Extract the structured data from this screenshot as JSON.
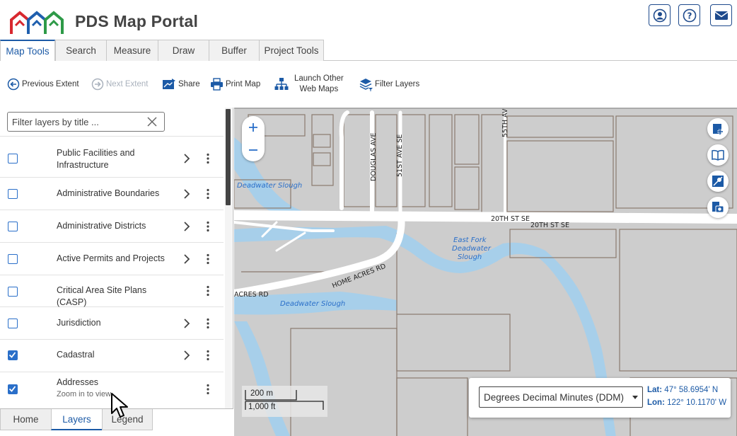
{
  "header": {
    "title": "PDS Map Portal",
    "buttons": [
      {
        "name": "account-button",
        "icon": "user-icon"
      },
      {
        "name": "help-button",
        "icon": "help-icon"
      },
      {
        "name": "contact-button",
        "icon": "mail-icon"
      }
    ]
  },
  "tabs": [
    "Map Tools",
    "Search",
    "Measure",
    "Draw",
    "Buffer",
    "Project Tools"
  ],
  "toolbar": {
    "previous_extent": "Previous Extent",
    "next_extent": "Next Extent",
    "share": "Share",
    "print_map": "Print Map",
    "launch_line1": "Launch Other",
    "launch_line2": "Web Maps",
    "filter_layers": "Filter Layers"
  },
  "filter": {
    "placeholder": "Filter layers by title ..."
  },
  "layers": [
    {
      "line1": "Public Facilities and",
      "line2": "Infrastructure",
      "checked": false,
      "has_children": true
    },
    {
      "line1": "Administrative Boundaries",
      "checked": false,
      "has_children": true
    },
    {
      "line1": "Administrative Districts",
      "checked": false,
      "has_children": true
    },
    {
      "line1": "Active Permits and Projects",
      "checked": false,
      "has_children": true
    },
    {
      "line1": "Critical Area Site Plans (CASP)",
      "checked": false,
      "has_children": false
    },
    {
      "line1": "Jurisdiction",
      "checked": false,
      "has_children": true
    },
    {
      "line1": "Cadastral",
      "checked": true,
      "has_children": true
    },
    {
      "line1": "Addresses",
      "sub": "Zoom in to view",
      "checked": true,
      "has_children": false
    }
  ],
  "bottom_tabs": [
    "Home",
    "Layers",
    "Legend"
  ],
  "map": {
    "labels": {
      "douglas": "DOUGLAS AVE",
      "st51": "51ST AVE SE",
      "st55": "55TH AV",
      "st20a": "20TH ST SE",
      "st20b": "20TH ST SE",
      "homeacres": "HOME ACRES RD",
      "acres": "ACRES RD",
      "slough1": "Deadwater Slough",
      "slough2": "Deadwater Slough",
      "eastfork1": "East Fork",
      "eastfork2": "Deadwater",
      "eastfork3": "Slough"
    },
    "scale": {
      "metric": "200 m",
      "imperial": "1,000 ft"
    },
    "coordinates": {
      "format": "Degrees Decimal Minutes (DDM)",
      "lat_label": "Lat:",
      "lat_value": "47° 58.6954' N",
      "lon_label": "Lon:",
      "lon_value": "122° 10.1170' W"
    }
  },
  "colors": {
    "accent": "#1c5aa6",
    "checkbox": "#2a6fc9",
    "water": "#a7cfea",
    "parcel": "#cdcdcd",
    "road": "#ffffff"
  }
}
